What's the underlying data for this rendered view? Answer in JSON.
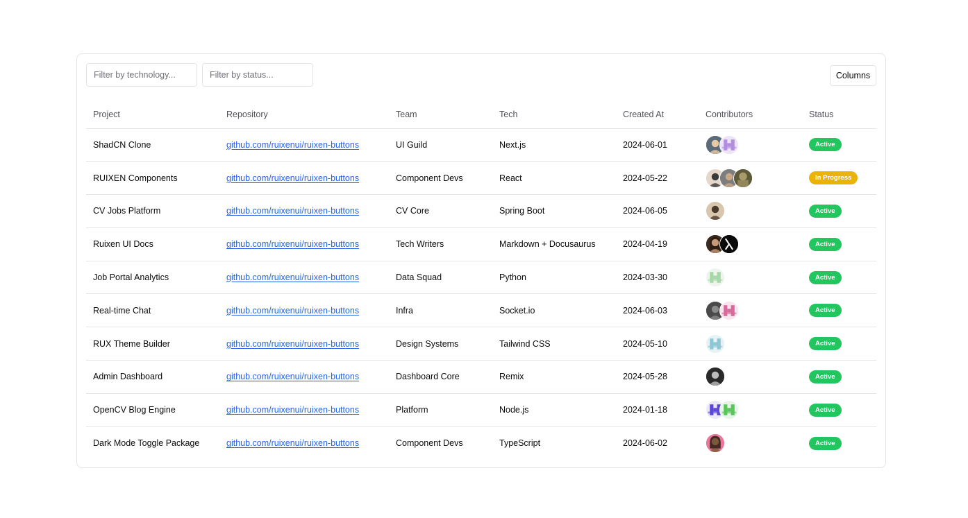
{
  "filters": {
    "technology_placeholder": "Filter by technology...",
    "status_placeholder": "Filter by status..."
  },
  "toolbar": {
    "columns_label": "Columns"
  },
  "headers": {
    "project": "Project",
    "repository": "Repository",
    "team": "Team",
    "tech": "Tech",
    "created_at": "Created At",
    "contributors": "Contributors",
    "status": "Status"
  },
  "colors": {
    "active": "#22c55e",
    "in_progress": "#eab308",
    "link": "#2563eb"
  },
  "rows": [
    {
      "project": "ShadCN Clone",
      "repository": "github.com/ruixenui/ruixen-buttons",
      "team": "UI Guild",
      "tech": "Next.js",
      "created_at": "2024-06-01",
      "status": "Active",
      "status_color": "#22c55e",
      "contributors": [
        {
          "icon": "avatar-photo-man-icon",
          "bg": "#5b6b7a",
          "fg": "#e8c9a5"
        },
        {
          "icon": "avatar-identicon-icon",
          "bg": "#ede4f7",
          "fg": "#b38ee0"
        }
      ]
    },
    {
      "project": "RUIXEN Components",
      "repository": "github.com/ruixenui/ruixen-buttons",
      "team": "Component Devs",
      "tech": "React",
      "created_at": "2024-05-22",
      "status": "In Progress",
      "status_color": "#eab308",
      "contributors": [
        {
          "icon": "avatar-photo-man-icon",
          "bg": "#e6d8c8",
          "fg": "#3a3a3a"
        },
        {
          "icon": "avatar-photo-man-icon",
          "bg": "#7d7d7d",
          "fg": "#c9a88a"
        },
        {
          "icon": "avatar-photo-landscape-icon",
          "bg": "#5d5a3a",
          "fg": "#a99a6a"
        }
      ]
    },
    {
      "project": "CV Jobs Platform",
      "repository": "github.com/ruixenui/ruixen-buttons",
      "team": "CV Core",
      "tech": "Spring Boot",
      "created_at": "2024-06-05",
      "status": "Active",
      "status_color": "#22c55e",
      "contributors": [
        {
          "icon": "avatar-photo-man-icon",
          "bg": "#d8c7ad",
          "fg": "#4a3a2a"
        }
      ]
    },
    {
      "project": "Ruixen UI Docs",
      "repository": "github.com/ruixenui/ruixen-buttons",
      "team": "Tech Writers",
      "tech": "Markdown + Docusaurus",
      "created_at": "2024-04-19",
      "status": "Active",
      "status_color": "#22c55e",
      "contributors": [
        {
          "icon": "avatar-photo-woman-icon",
          "bg": "#3a2a20",
          "fg": "#c49a7a"
        },
        {
          "icon": "avatar-lambda-icon",
          "bg": "#0a0a0a",
          "fg": "#ffffff"
        }
      ]
    },
    {
      "project": "Job Portal Analytics",
      "repository": "github.com/ruixenui/ruixen-buttons",
      "team": "Data Squad",
      "tech": "Python",
      "created_at": "2024-03-30",
      "status": "Active",
      "status_color": "#22c55e",
      "contributors": [
        {
          "icon": "avatar-identicon-icon",
          "bg": "#eef5ee",
          "fg": "#a8d8a8"
        }
      ]
    },
    {
      "project": "Real-time Chat",
      "repository": "github.com/ruixenui/ruixen-buttons",
      "team": "Infra",
      "tech": "Socket.io",
      "created_at": "2024-06-03",
      "status": "Active",
      "status_color": "#22c55e",
      "contributors": [
        {
          "icon": "avatar-photo-man-icon",
          "bg": "#4a4a4a",
          "fg": "#8a8a8a"
        },
        {
          "icon": "avatar-identicon-icon",
          "bg": "#f7e4ee",
          "fg": "#d66a9a"
        }
      ]
    },
    {
      "project": "RUX Theme Builder",
      "repository": "github.com/ruixenui/ruixen-buttons",
      "team": "Design Systems",
      "tech": "Tailwind CSS",
      "created_at": "2024-05-10",
      "status": "Active",
      "status_color": "#22c55e",
      "contributors": [
        {
          "icon": "avatar-identicon-icon",
          "bg": "#e6f2f5",
          "fg": "#8ec6d6"
        }
      ]
    },
    {
      "project": "Admin Dashboard",
      "repository": "github.com/ruixenui/ruixen-buttons",
      "team": "Dashboard Core",
      "tech": "Remix",
      "created_at": "2024-05-28",
      "status": "Active",
      "status_color": "#22c55e",
      "contributors": [
        {
          "icon": "avatar-photo-man-icon",
          "bg": "#2a2a2a",
          "fg": "#bdbdbd"
        }
      ]
    },
    {
      "project": "OpenCV Blog Engine",
      "repository": "github.com/ruixenui/ruixen-buttons",
      "team": "Platform",
      "tech": "Node.js",
      "created_at": "2024-01-18",
      "status": "Active",
      "status_color": "#22c55e",
      "contributors": [
        {
          "icon": "avatar-identicon-icon",
          "bg": "#ebe8f7",
          "fg": "#5b47d6"
        },
        {
          "icon": "avatar-identicon-icon",
          "bg": "#e6f5e6",
          "fg": "#5cc45c"
        }
      ]
    },
    {
      "project": "Dark Mode Toggle Package",
      "repository": "github.com/ruixenui/ruixen-buttons",
      "team": "Component Devs",
      "tech": "TypeScript",
      "created_at": "2024-06-02",
      "status": "Active",
      "status_color": "#22c55e",
      "contributors": [
        {
          "icon": "avatar-photo-woman-icon",
          "bg": "#e8789a",
          "fg": "#7a5a3a"
        }
      ]
    }
  ]
}
